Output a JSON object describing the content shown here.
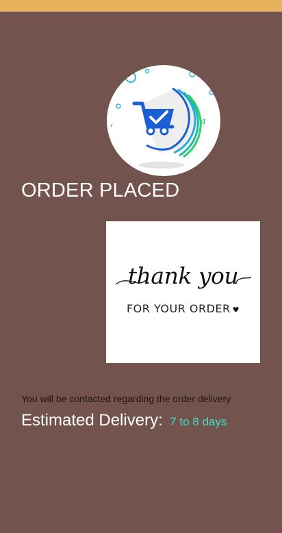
{
  "colors": {
    "status_strip": "#e6b25c",
    "background": "#73534e",
    "accent_text": "#3fe0c4",
    "cart_blue": "#1b5fd6"
  },
  "header": {
    "illustration_icon": "shopping-cart-check-icon"
  },
  "title": "ORDER PLACED",
  "thanks_card": {
    "script_text": "thank you",
    "subtitle": "FOR YOUR ORDER",
    "icon": "heart-icon"
  },
  "info": {
    "contact_note": "You will be contacted regarding the order delivery",
    "estimated_label": "Estimated Delivery:",
    "estimated_value": "7 to 8 days"
  }
}
